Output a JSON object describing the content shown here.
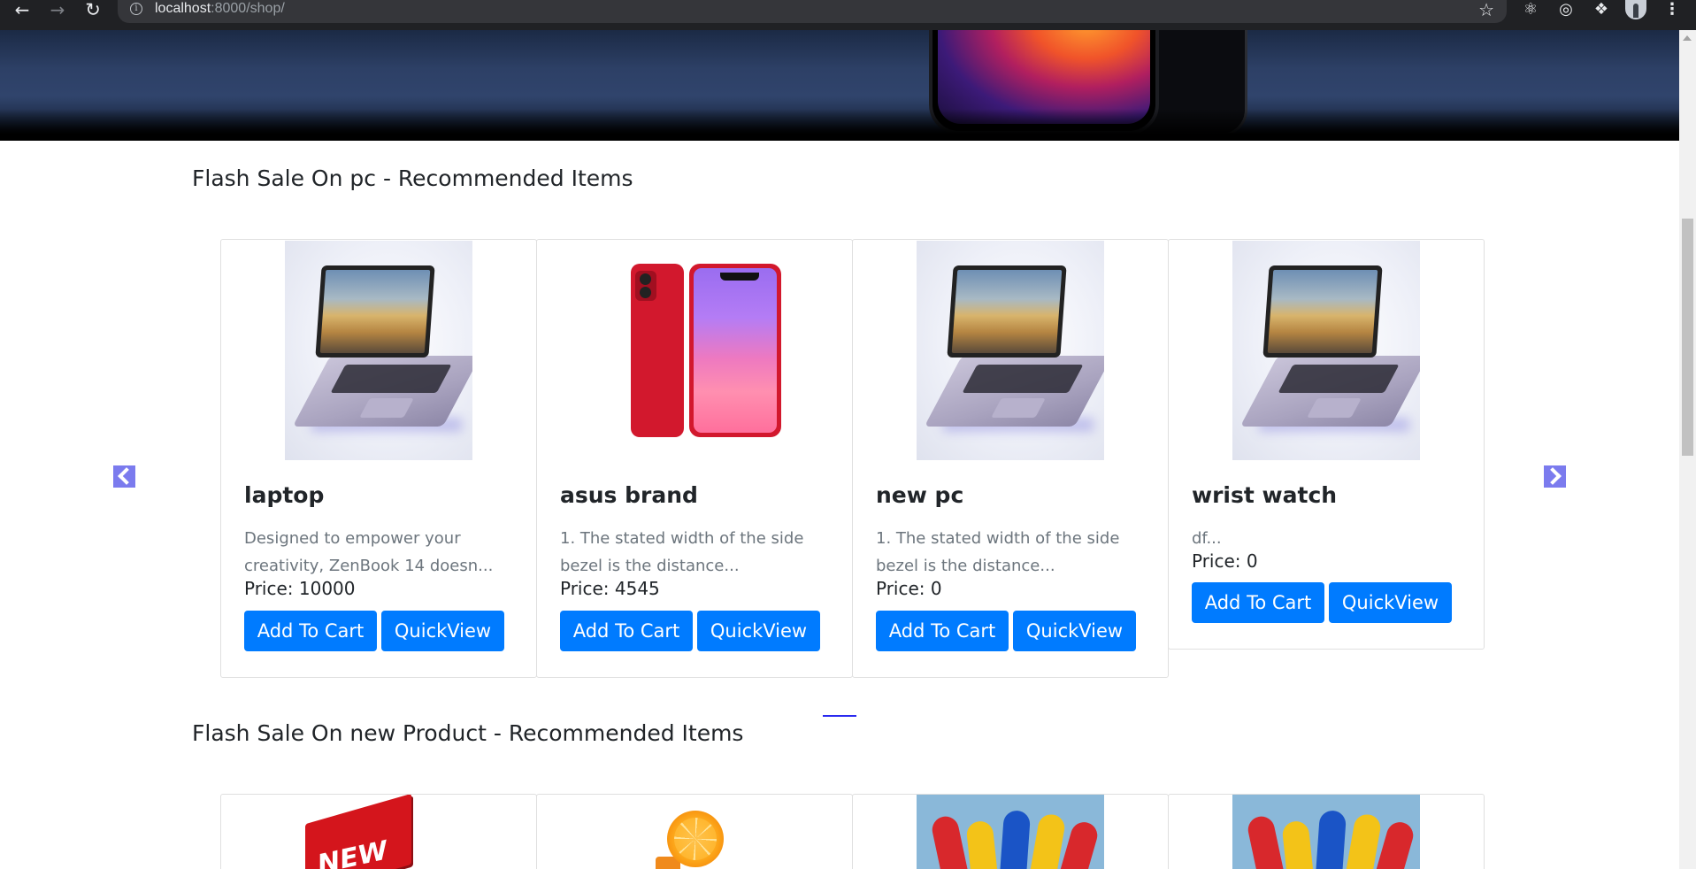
{
  "browser": {
    "url_host": "localhost",
    "url_path": ":8000/shop/",
    "back_icon": "arrow-left-icon",
    "forward_icon": "arrow-right-icon",
    "reload_icon": "reload-icon",
    "bookmark_icon": "star-icon",
    "extensions": [
      "react-devtools-icon",
      "target-icon",
      "puzzle-extensions-icon",
      "profile-avatar",
      "kebab-menu-icon"
    ]
  },
  "hero": {
    "image": "smartphone-banner"
  },
  "sections": [
    {
      "title": "Flash Sale On pc - Recommended Items",
      "products": [
        {
          "name": "laptop",
          "description": "Designed to empower your creativity, ZenBook 14 doesn...",
          "price": "Price: 10000",
          "image": "laptop-image"
        },
        {
          "name": "asus brand",
          "description": "1. The stated width of the side bezel is the distance...",
          "price": "Price: 4545",
          "image": "iphone-image"
        },
        {
          "name": "new pc",
          "description": "1. The stated width of the side bezel is the distance...",
          "price": "Price: 0",
          "image": "laptop-image"
        },
        {
          "name": "wrist watch",
          "description": "df...",
          "price": "Price: 0",
          "image": "laptop-image"
        }
      ]
    },
    {
      "title": "Flash Sale On new Product - Recommended Items",
      "products": [
        {
          "image": "new-badge-image"
        },
        {
          "image": "orange-juice-image"
        },
        {
          "image": "sandals-image"
        },
        {
          "image": "sandals-image"
        }
      ]
    }
  ],
  "buttons": {
    "add_to_cart": "Add To Cart",
    "quick_view": "QuickView"
  },
  "carousel": {
    "prev_icon": "chevron-left-icon",
    "next_icon": "chevron-right-icon",
    "accent": "#7b7bee",
    "indicator_color": "#2a2aef"
  },
  "colors": {
    "primary_button": "#007bff",
    "muted_text": "#6c757d",
    "card_border": "#dfdfdf"
  }
}
